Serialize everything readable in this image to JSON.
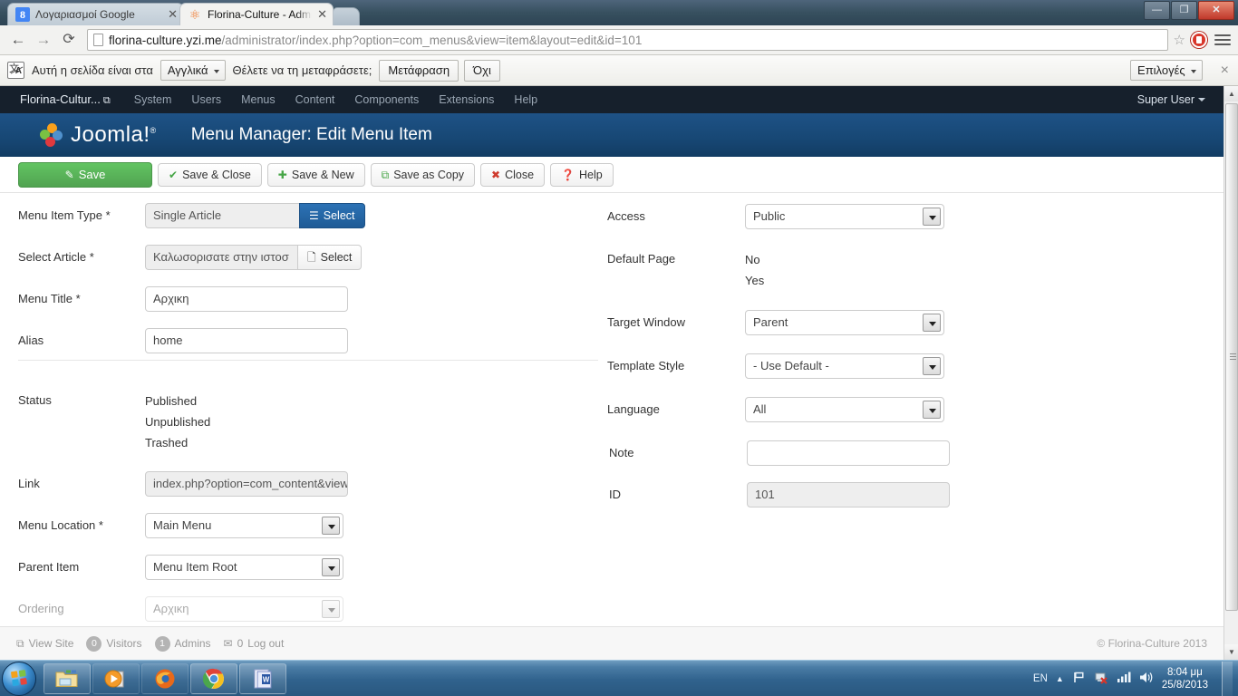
{
  "browser": {
    "tabs": [
      {
        "title": "Λογαριασμοί Google",
        "favicon": "google-icon",
        "favicon_letter": "8",
        "active": false
      },
      {
        "title": "Florina-Culture - Adminis",
        "favicon": "joomla-icon",
        "active": true
      }
    ],
    "window_controls": {
      "minimize": "—",
      "maximize": "❐",
      "close": "✕"
    },
    "nav": {
      "back": "←",
      "forward": "→",
      "reload": "⟳"
    },
    "url": {
      "host": "florina-culture.yzi.me",
      "path": "/administrator/index.php?option=com_menus&view=item&layout=edit&id=101"
    },
    "bookmark_star": "☆",
    "extension_icon": "adblock-icon",
    "menu_icon": "hamburger-menu-icon"
  },
  "infobar": {
    "icon": "translate-icon",
    "message": "Αυτή η σελίδα είναι στα",
    "language_select": "Αγγλικά",
    "question": "Θέλετε να τη μεταφράσετε;",
    "translate_button": "Μετάφραση",
    "decline_button": "Όχι",
    "options_button": "Επιλογές",
    "close": "×"
  },
  "joomla": {
    "topbar": {
      "site_name": "Florina-Cultur...",
      "site_external_icon": "external-link-icon",
      "menu": [
        "System",
        "Users",
        "Menus",
        "Content",
        "Components",
        "Extensions",
        "Help"
      ],
      "user": "Super User"
    },
    "header": {
      "logo_text": "Joomla!",
      "logo_sup": "®",
      "page_title": "Menu Manager: Edit Menu Item"
    },
    "toolbar": [
      {
        "label": "Save",
        "icon": "edit-icon",
        "style": "primary"
      },
      {
        "label": "Save & Close",
        "icon": "check-icon",
        "style": "default"
      },
      {
        "label": "Save & New",
        "icon": "plus-icon",
        "style": "default"
      },
      {
        "label": "Save as Copy",
        "icon": "copy-icon",
        "style": "default"
      },
      {
        "label": "Close",
        "icon": "close-circle-icon",
        "style": "default"
      },
      {
        "label": "Help",
        "icon": "help-circle-icon",
        "style": "default"
      }
    ],
    "form_left": {
      "menu_item_type": {
        "label": "Menu Item Type *",
        "value": "Single Article",
        "button": "Select",
        "button_icon": "list-icon"
      },
      "select_article": {
        "label": "Select Article *",
        "value": "Καλωσορισατε στην ιστοσ",
        "button": "Select",
        "button_icon": "file-icon"
      },
      "menu_title": {
        "label": "Menu Title *",
        "value": "Αρχικη"
      },
      "alias": {
        "label": "Alias",
        "value": "home"
      },
      "status": {
        "label": "Status",
        "options": [
          "Published",
          "Unpublished",
          "Trashed"
        ]
      },
      "link": {
        "label": "Link",
        "value": "index.php?option=com_content&view"
      },
      "menu_location": {
        "label": "Menu Location *",
        "value": "Main Menu"
      },
      "parent_item": {
        "label": "Parent Item",
        "value": "Menu Item Root"
      },
      "ordering": {
        "label": "Ordering",
        "value": "Αρχικη"
      }
    },
    "form_right": {
      "access": {
        "label": "Access",
        "value": "Public"
      },
      "default_page": {
        "label": "Default Page",
        "options": [
          "No",
          "Yes"
        ]
      },
      "target_window": {
        "label": "Target Window",
        "value": "Parent"
      },
      "template_style": {
        "label": "Template Style",
        "value": "- Use Default -"
      },
      "language": {
        "label": "Language",
        "value": "All"
      },
      "note": {
        "label": "Note",
        "value": ""
      },
      "id": {
        "label": "ID",
        "value": "101"
      }
    },
    "footer": {
      "view_site": "View Site",
      "view_site_icon": "external-link-icon",
      "visitors_count": "0",
      "visitors_label": "Visitors",
      "admins_count": "1",
      "admins_label": "Admins",
      "messages_icon": "envelope-icon",
      "messages_count": "0",
      "logout": "Log out",
      "copyright": "© Florina-Culture 2013"
    }
  },
  "taskbar": {
    "start": "windows-start-orb",
    "items": [
      {
        "name": "file-explorer-icon"
      },
      {
        "name": "media-player-icon"
      },
      {
        "name": "firefox-icon"
      },
      {
        "name": "chrome-icon"
      },
      {
        "name": "word-icon"
      }
    ],
    "tray": {
      "language": "EN",
      "show_hidden": "▲",
      "icons": [
        "action-center-flag-icon",
        "network-error-icon",
        "signal-bars-icon",
        "volume-icon"
      ],
      "time": "8:04 μμ",
      "date": "25/8/2013"
    }
  },
  "colors": {
    "joomla_dark": "#16202c",
    "joomla_blue": "#174774",
    "save_green": "#51a351",
    "select_blue": "#1f5b96"
  }
}
